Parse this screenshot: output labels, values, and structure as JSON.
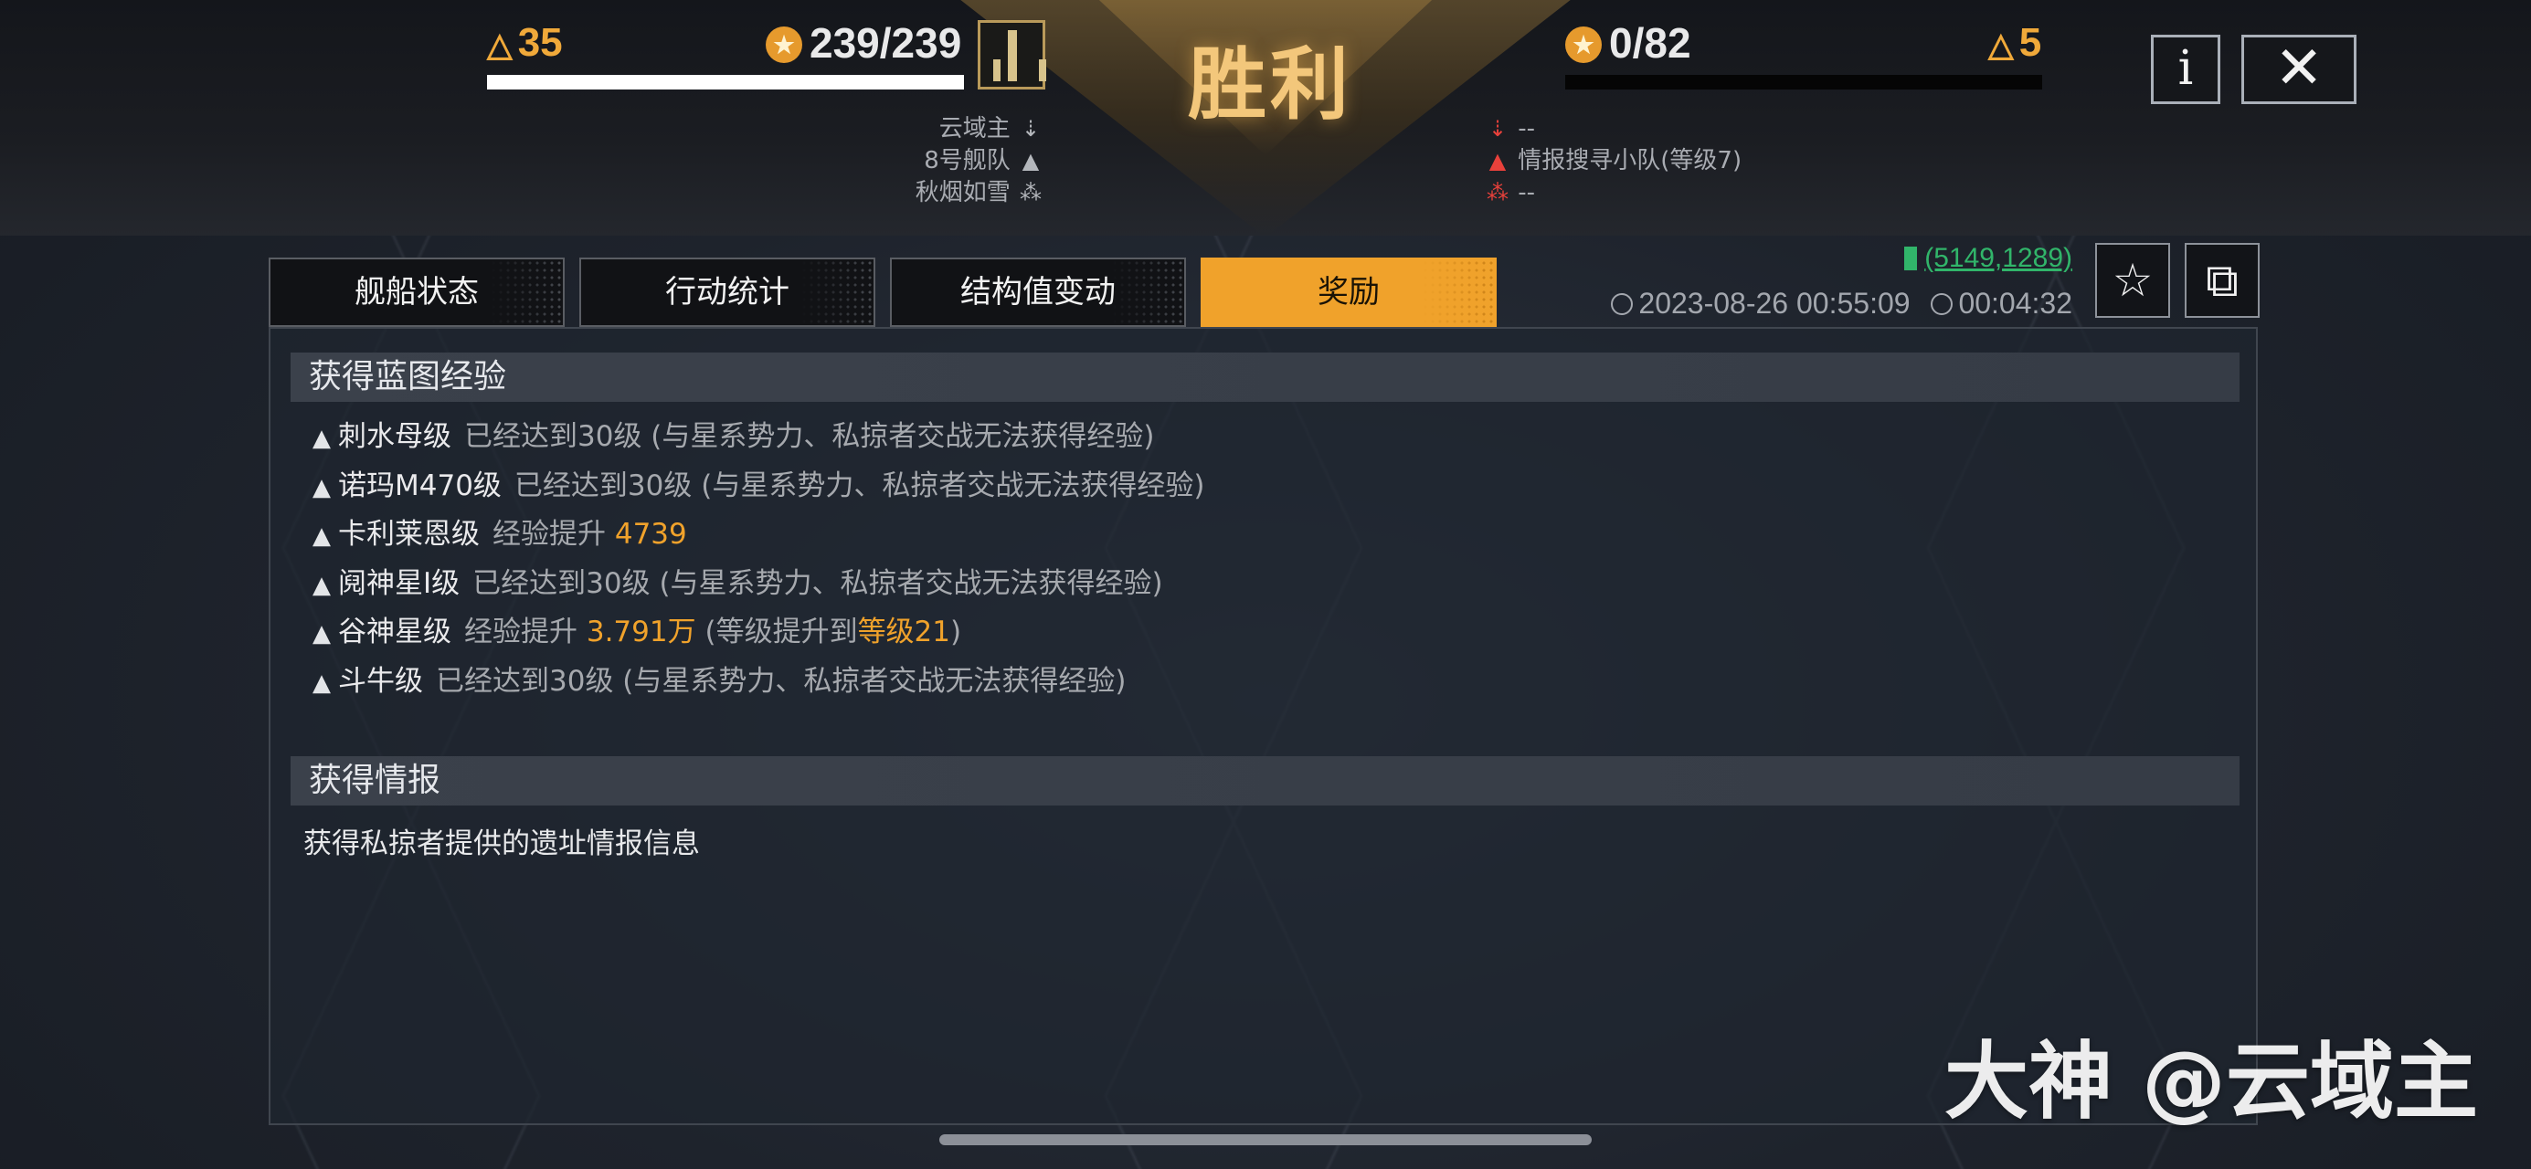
{
  "header": {
    "result": "胜利",
    "left": {
      "level": "35",
      "hp": "239/239"
    },
    "right": {
      "level": "5",
      "hp": "0/82"
    },
    "info_label": "i",
    "close_label": "✕",
    "left_info": [
      {
        "text": "云域主",
        "icon": "sword-down-icon"
      },
      {
        "text": "8号舰队",
        "icon": "chevron-up-icon"
      },
      {
        "text": "秋烟如雪",
        "icon": "unit-icon"
      }
    ],
    "right_info": [
      {
        "text": "--",
        "icon": "sword-down-icon"
      },
      {
        "text": "情报搜寻小队(等级7)",
        "icon": "chevron-up-icon"
      },
      {
        "text": "--",
        "icon": "unit-icon"
      }
    ]
  },
  "tabs": [
    {
      "label": "舰船状态",
      "active": false
    },
    {
      "label": "行动统计",
      "active": false
    },
    {
      "label": "结构值变动",
      "active": false
    },
    {
      "label": "奖励",
      "active": true
    }
  ],
  "location": "(5149,1289)",
  "datetime": "2023-08-26 00:55:09",
  "duration": "00:04:32",
  "blueprint": {
    "title": "获得蓝图经验",
    "ships": [
      {
        "name": "刺水母级",
        "desc": "已经达到30级 (与星系势力、私掠者交战无法获得经验)"
      },
      {
        "name": "诺玛M470级",
        "desc": "已经达到30级 (与星系势力、私掠者交战无法获得经验)"
      },
      {
        "name": "卡利莱恩级",
        "desc": "经验提升",
        "value": "4739"
      },
      {
        "name": "阋神星I级",
        "desc": "已经达到30级 (与星系势力、私掠者交战无法获得经验)"
      },
      {
        "name": "谷神星级",
        "desc": "经验提升",
        "value": "3.791万",
        "extra_pre": "(等级提升到",
        "extra_value": "等级21",
        "extra_post": ")"
      },
      {
        "name": "斗牛级",
        "desc": "已经达到30级 (与星系势力、私掠者交战无法获得经验)"
      }
    ]
  },
  "intel": {
    "title": "获得情报",
    "text": "获得私掠者提供的遗址情报信息"
  },
  "watermark": "大神 @云域主",
  "colors": {
    "accent": "#f0a22b",
    "victory": "#f3c77b",
    "coord": "#31b56a",
    "enemy": "#e8413b"
  }
}
